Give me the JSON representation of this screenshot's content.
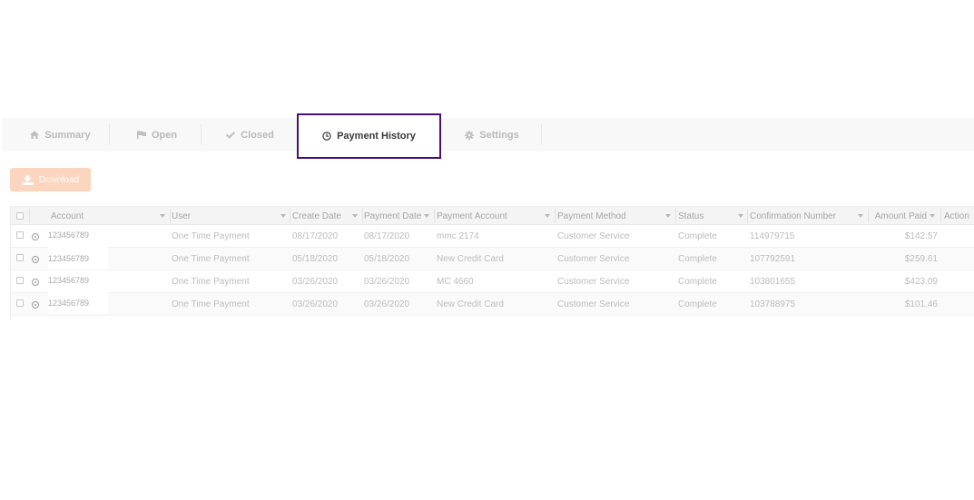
{
  "tabs": [
    {
      "label": "Summary",
      "icon": "home-icon"
    },
    {
      "label": "Open",
      "icon": "flag-icon"
    },
    {
      "label": "Closed",
      "icon": "checkmark-icon"
    },
    {
      "label": "Payment History",
      "icon": "clock-icon",
      "active": true
    },
    {
      "label": "Settings",
      "icon": "gear-icon"
    }
  ],
  "toolbar": {
    "download_label": "Download",
    "download_icon": "download-icon"
  },
  "grid": {
    "columns": [
      {
        "label": "",
        "type": "select-all-checkbox"
      },
      {
        "label": "Account"
      },
      {
        "label": "User"
      },
      {
        "label": "Create Date"
      },
      {
        "label": "Payment Date"
      },
      {
        "label": "Payment Account"
      },
      {
        "label": "Payment Method"
      },
      {
        "label": "Status"
      },
      {
        "label": "Confirmation Number"
      },
      {
        "label": "Amount Paid"
      },
      {
        "label": "Action"
      }
    ],
    "rows": [
      {
        "account": "123456789",
        "user": "One Time Payment",
        "create_date": "08/17/2020",
        "payment_date": "08/17/2020",
        "payment_account": "mmc 2174",
        "payment_method": "Customer Service",
        "status": "Complete",
        "confirmation": "114979715",
        "amount": "$142.57"
      },
      {
        "account": "123456789",
        "user": "One Time Payment",
        "create_date": "05/18/2020",
        "payment_date": "05/18/2020",
        "payment_account": "New Credit Card",
        "payment_method": "Customer Service",
        "status": "Complete",
        "confirmation": "107792591",
        "amount": "$259.61"
      },
      {
        "account": "123456789",
        "user": "One Time Payment",
        "create_date": "03/26/2020",
        "payment_date": "03/26/2020",
        "payment_account": "MC 4660",
        "payment_method": "Customer Service",
        "status": "Complete",
        "confirmation": "103801655",
        "amount": "$423.09"
      },
      {
        "account": "123456789",
        "user": "One Time Payment",
        "create_date": "03/26/2020",
        "payment_date": "03/26/2020",
        "payment_account": "New Credit Card",
        "payment_method": "Customer Service",
        "status": "Complete",
        "confirmation": "103788975",
        "amount": "$101.46"
      }
    ]
  },
  "colors": {
    "active_tab_border": "#4b0f73",
    "download_button": "#fcd5bf"
  }
}
